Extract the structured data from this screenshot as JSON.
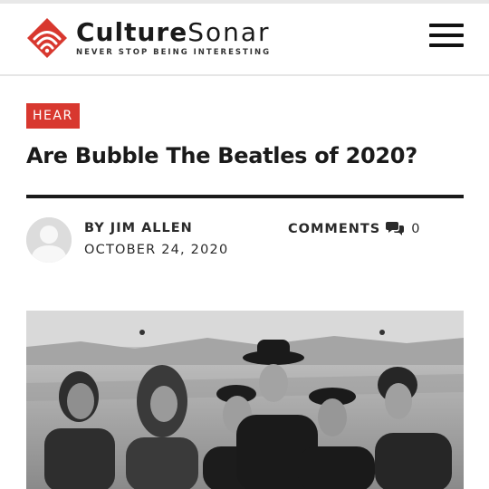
{
  "header": {
    "brand_part1": "Culture",
    "brand_part2": "Sonar",
    "tagline": "NEVER STOP BEING INTERESTING",
    "brand_color": "#d8382f"
  },
  "article": {
    "category": "HEAR",
    "title": "Are Bubble The Beatles of 2020?",
    "byline": "BY JIM ALLEN",
    "date": "OCTOBER 24, 2020",
    "comments_label": "COMMENTS",
    "comments_count": "0"
  },
  "icons": {
    "logo": "sonar-logo-icon",
    "menu": "hamburger-menu-icon",
    "comments": "speech-bubbles-icon",
    "avatar": "default-user-avatar"
  }
}
